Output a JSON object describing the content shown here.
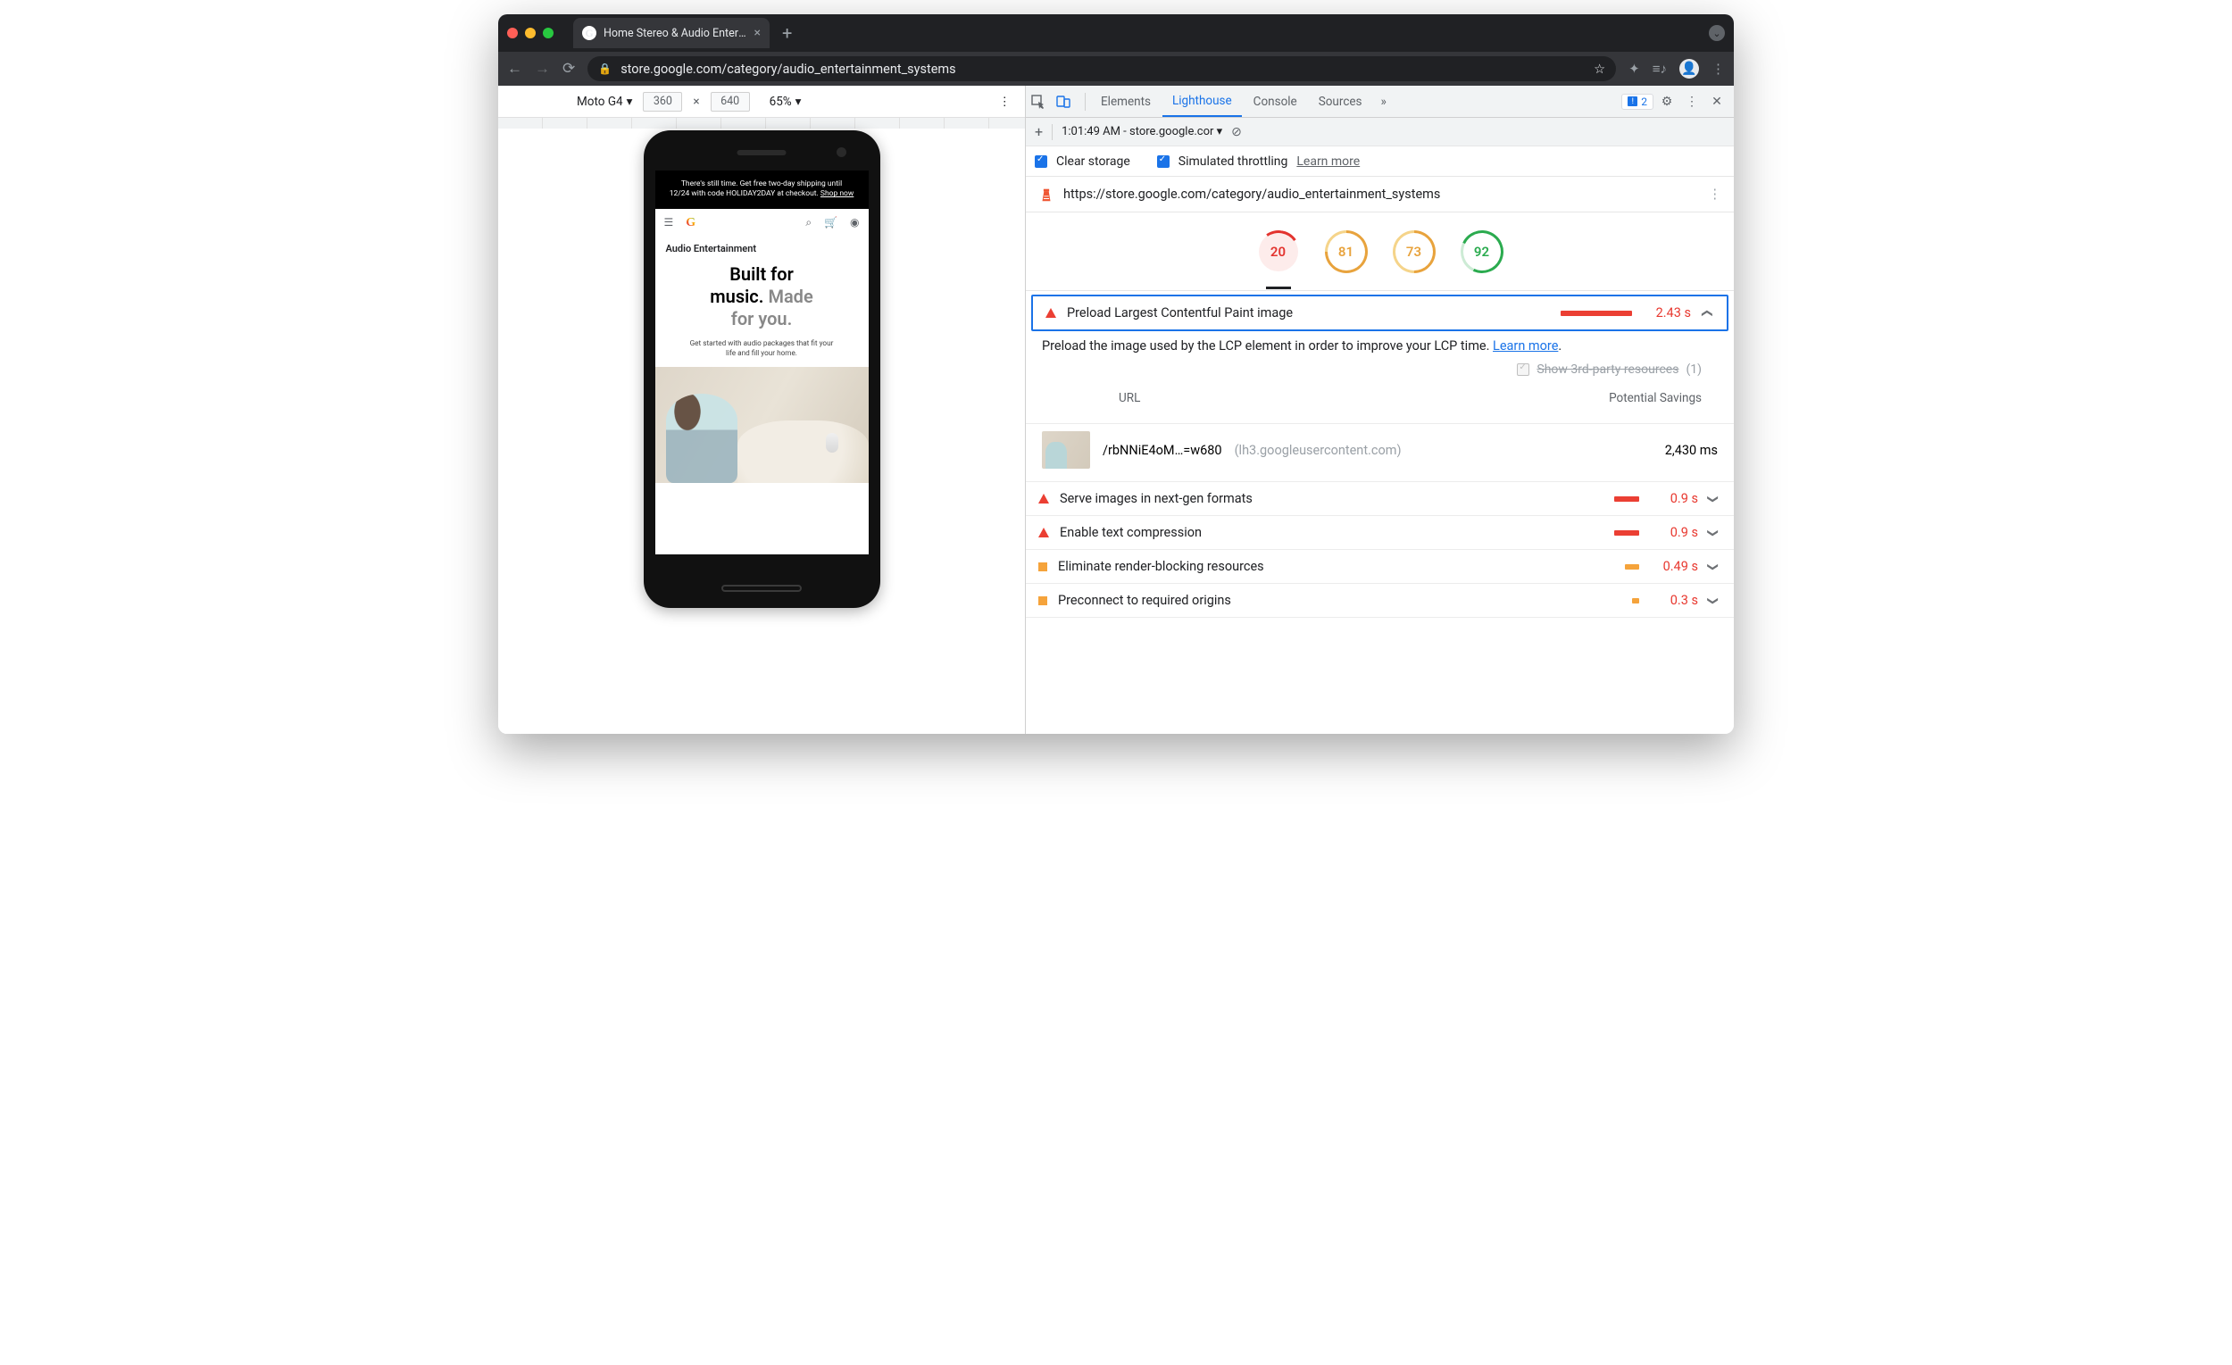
{
  "browser": {
    "tab_title": "Home Stereo & Audio Entertain…",
    "url_display": "store.google.com/category/audio_entertainment_systems"
  },
  "device_toolbar": {
    "device": "Moto G4",
    "width": "360",
    "height": "640",
    "zoom": "65%"
  },
  "phone_page": {
    "banner_line1": "There's still time. Get free two-day shipping until",
    "banner_line2": "12/24 with code HOLIDAY2DAY at checkout. ",
    "banner_link": "Shop now",
    "section_title": "Audio Entertainment",
    "hero_b1": "Built for",
    "hero_b2": "music.",
    "hero_g1": "Made",
    "hero_g2": "for you.",
    "subcopy": "Get started with audio packages that fit your life and fill your home."
  },
  "devtools": {
    "tabs": {
      "elements": "Elements",
      "lighthouse": "Lighthouse",
      "console": "Console",
      "sources": "Sources"
    },
    "error_count": "2",
    "report_label": "1:01:49 AM - store.google.cor",
    "clear_storage": "Clear storage",
    "sim_throttle": "Simulated throttling",
    "learn_more": "Learn more",
    "audit_url": "https://store.google.com/category/audio_entertainment_systems"
  },
  "scores": {
    "perf": "20",
    "a11y": "81",
    "bp": "73",
    "seo": "92"
  },
  "expanded": {
    "title": "Preload Largest Contentful Paint image",
    "time": "2.43 s",
    "desc_pre": "Preload the image used by the LCP element in order to improve your LCP time. ",
    "learn": "Learn more",
    "third_party_label": "Show 3rd-party resources",
    "third_party_count": "(1)",
    "col_url": "URL",
    "col_sav": "Potential Savings",
    "row_path": "/rbNNiE4oM…=w680",
    "row_host": "(lh3.googleusercontent.com)",
    "row_ms": "2,430 ms"
  },
  "audits": {
    "a1": {
      "t": "Serve images in next-gen formats",
      "v": "0.9 s"
    },
    "a2": {
      "t": "Enable text compression",
      "v": "0.9 s"
    },
    "a3": {
      "t": "Eliminate render-blocking resources",
      "v": "0.49 s"
    },
    "a4": {
      "t": "Preconnect to required origins",
      "v": "0.3 s"
    }
  }
}
